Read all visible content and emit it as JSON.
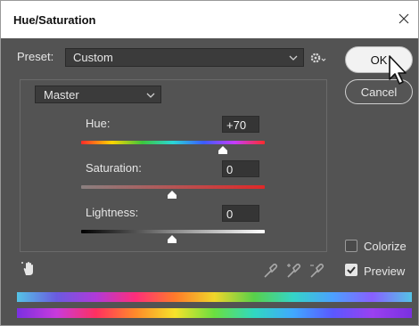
{
  "title": "Hue/Saturation",
  "preset": {
    "label": "Preset:",
    "value": "Custom"
  },
  "buttons": {
    "ok": "OK",
    "cancel": "Cancel"
  },
  "channel": {
    "value": "Master"
  },
  "sliders": {
    "hue": {
      "label": "Hue:",
      "value": "+70"
    },
    "saturation": {
      "label": "Saturation:",
      "value": "0"
    },
    "lightness": {
      "label": "Lightness:",
      "value": "0"
    }
  },
  "options": {
    "colorize": "Colorize",
    "preview": "Preview",
    "colorize_checked": false,
    "preview_checked": true
  },
  "icons": [
    "close-icon",
    "chevron-down-icon",
    "gear-icon",
    "targeted-adjustment-hand-icon",
    "eyedropper-icon",
    "eyedropper-plus-icon",
    "eyedropper-minus-icon",
    "checkmark-icon",
    "mouse-cursor-icon"
  ],
  "colors": {
    "dialog_bg": "#535353",
    "ok_button": "#f2f2f2",
    "saturation_track_end": "#e02828"
  }
}
